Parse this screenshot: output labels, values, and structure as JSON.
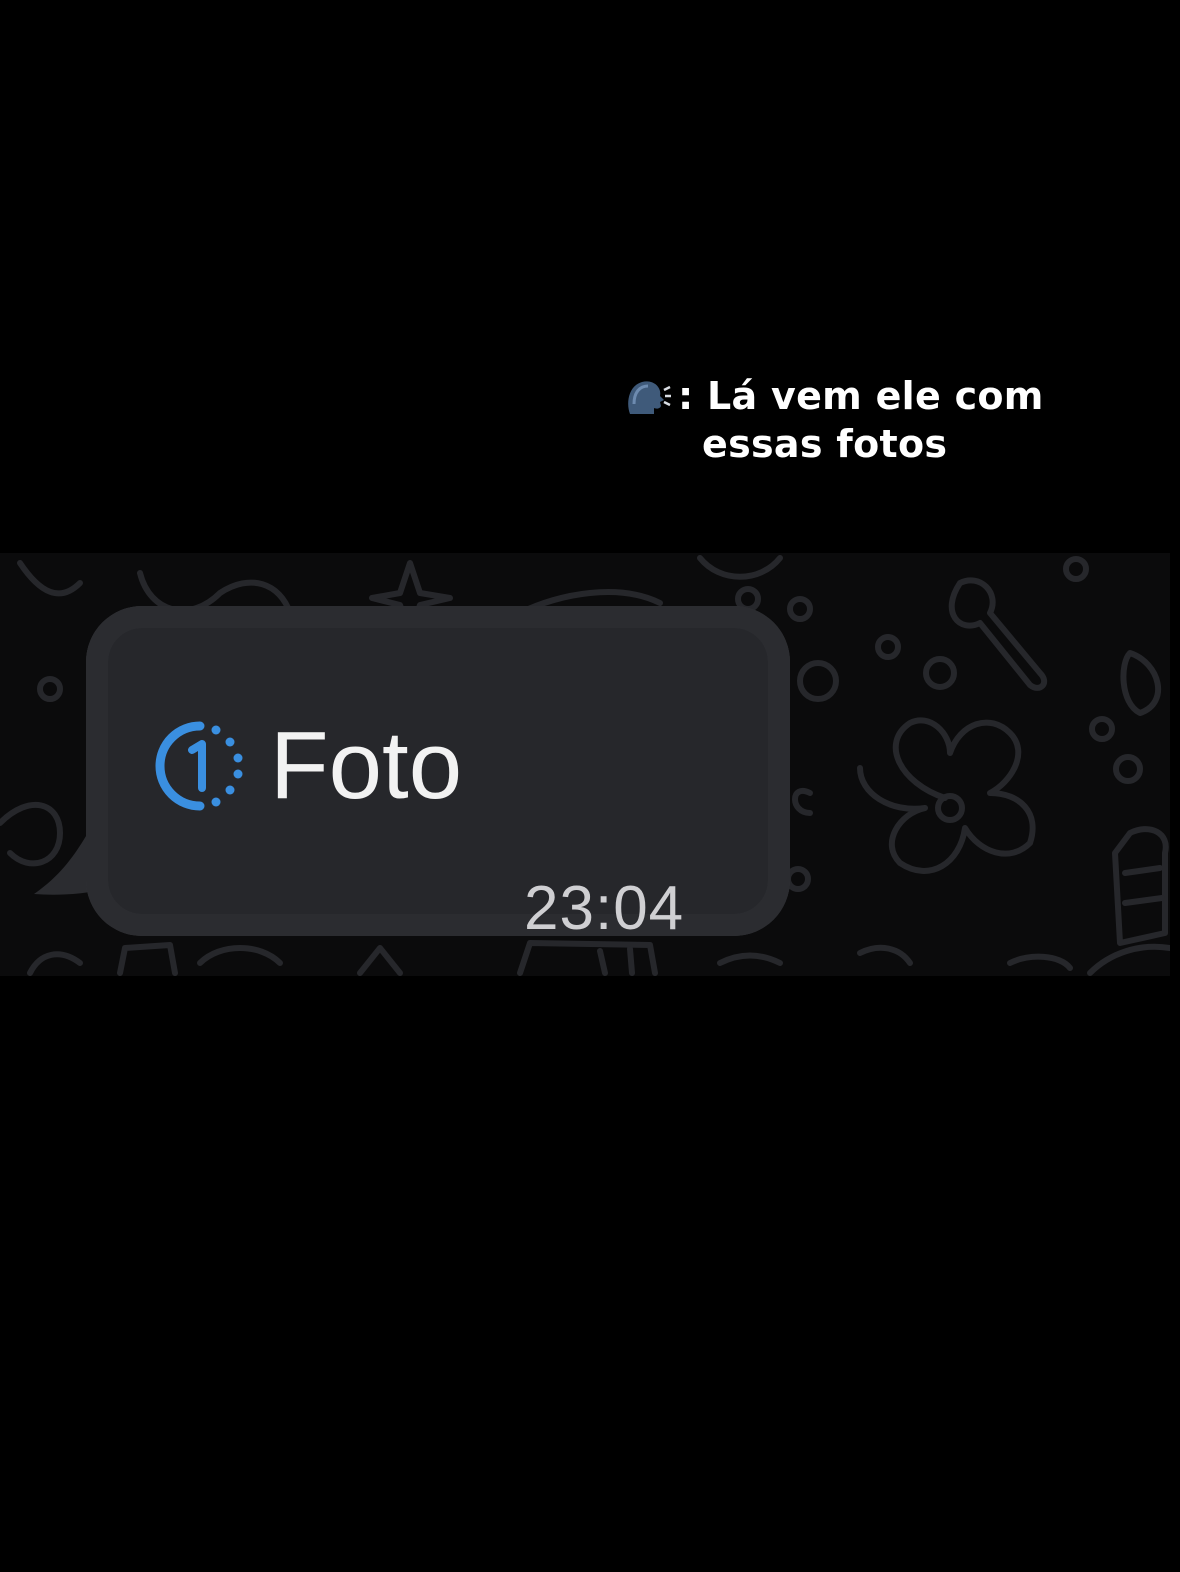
{
  "caption": {
    "emoji": "speaking-head-icon",
    "line1": ": Lá vem ele com",
    "line2": "essas fotos"
  },
  "message": {
    "icon": "view-once-icon",
    "label": "Foto",
    "time": "23:04"
  },
  "colors": {
    "background": "#000000",
    "bubble": "#2b2c30",
    "accent": "#3a8fe0",
    "text": "#f2f2f2",
    "time": "#cfcfd2"
  }
}
